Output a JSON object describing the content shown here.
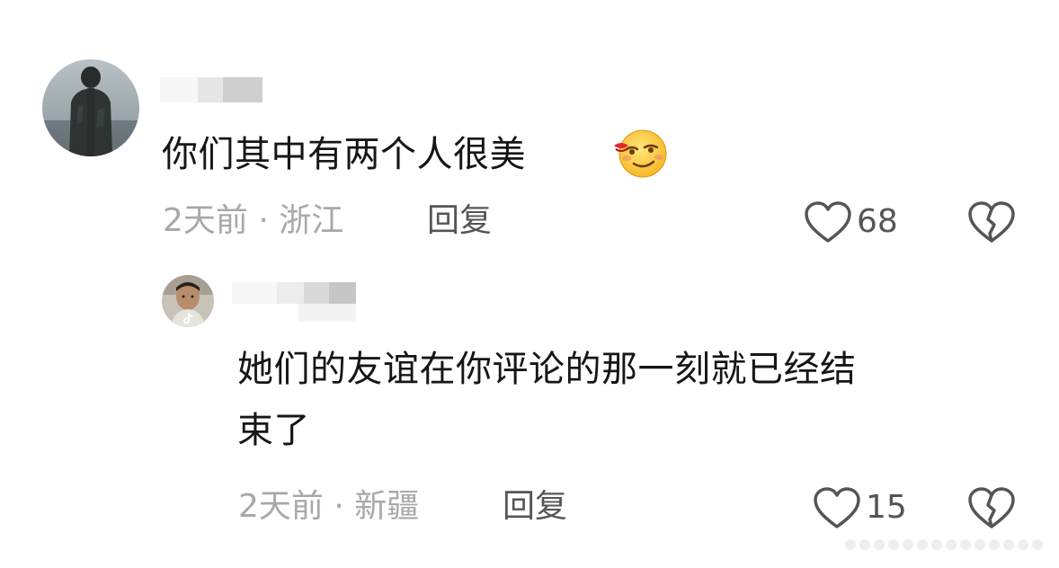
{
  "comments": [
    {
      "text": "你们其中有两个人很美",
      "emoji": "drooling-smirk-emoji",
      "time": "2天前",
      "separator": "·",
      "location": "浙江",
      "reply_label": "回复",
      "likes": "68",
      "like_icon": "heart-outline-icon",
      "dislike_icon": "broken-heart-icon"
    },
    {
      "text_line1": "她们的友谊在你评论的那一刻就已经结",
      "text_line2": "束了",
      "time": "2天前",
      "separator": "·",
      "location": "新疆",
      "reply_label": "回复",
      "likes": "15",
      "like_icon": "heart-outline-icon",
      "dislike_icon": "broken-heart-icon"
    }
  ],
  "colors": {
    "text": "#161616",
    "meta": "#a8a8a8",
    "action": "#555555",
    "icon": "#555555"
  }
}
